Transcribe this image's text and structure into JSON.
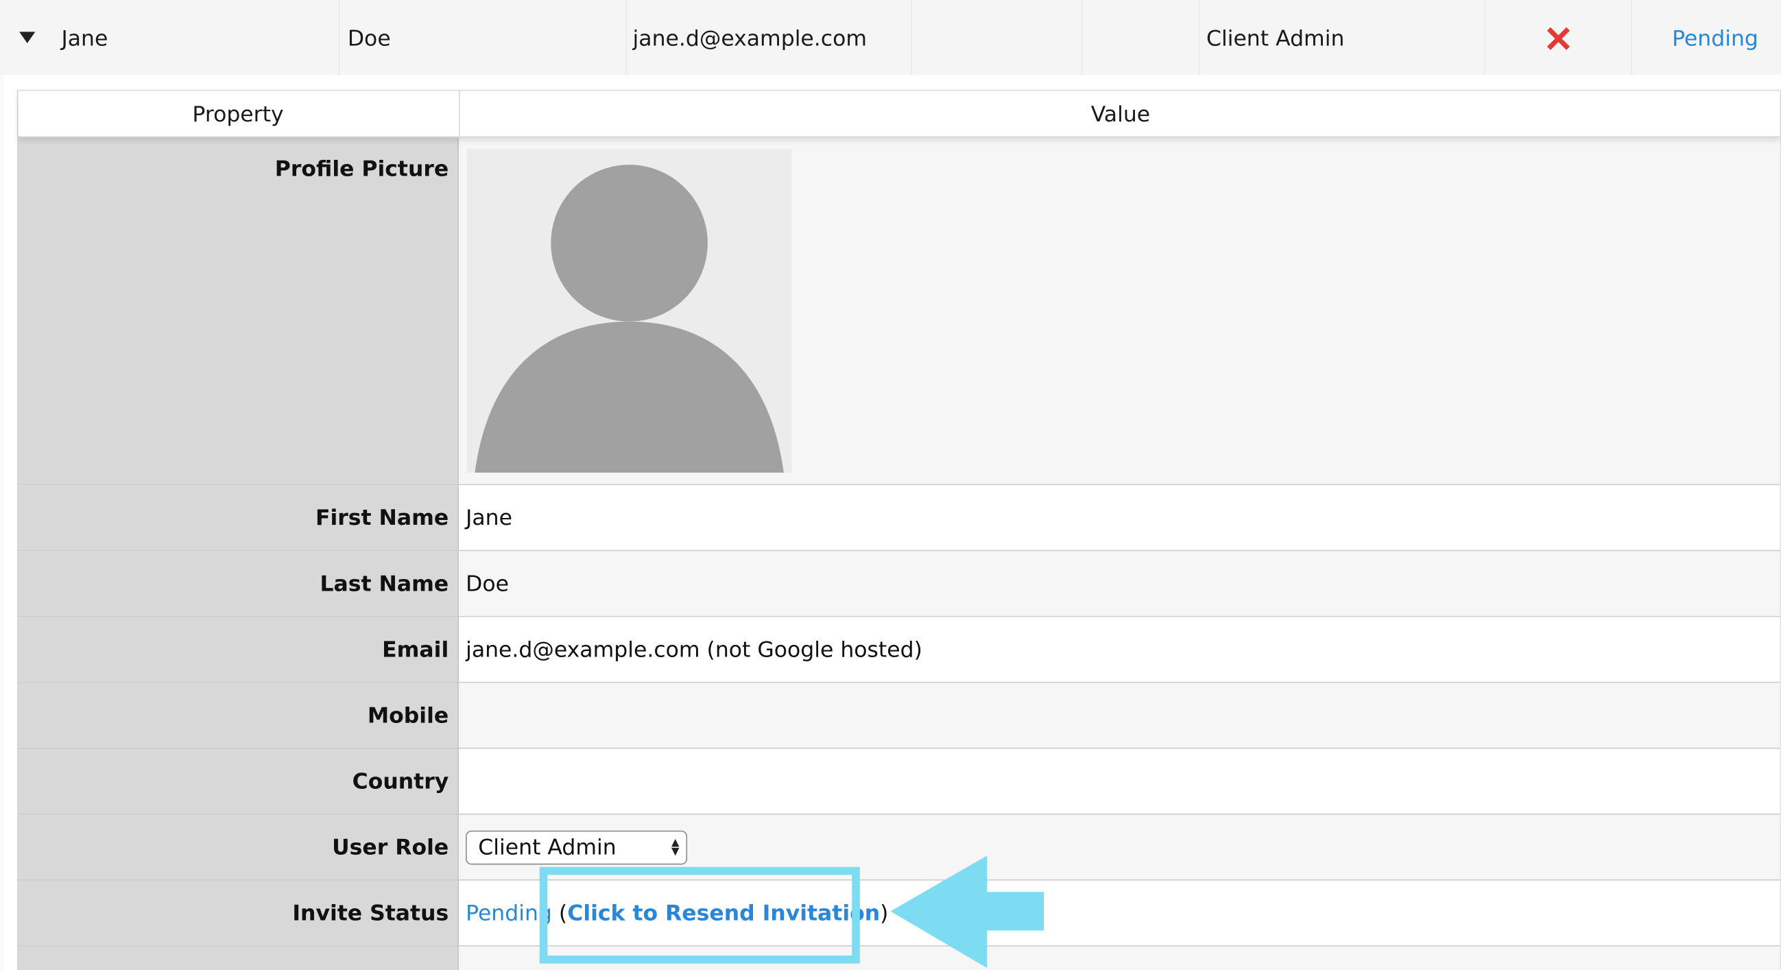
{
  "summary": {
    "first_name": "Jane",
    "last_name": "Doe",
    "email": "jane.d@example.com",
    "role": "Client Admin",
    "status": "Pending",
    "remove_icon": "x-icon",
    "expand_icon": "caret-down-icon"
  },
  "table": {
    "header_property": "Property",
    "header_value": "Value",
    "profile_picture_label": "Profile Picture",
    "rows": [
      {
        "label": "First Name",
        "value": "Jane"
      },
      {
        "label": "Last Name",
        "value": "Doe"
      },
      {
        "label": "Email",
        "value": "jane.d@example.com (not Google hosted)"
      },
      {
        "label": "Mobile",
        "value": ""
      },
      {
        "label": "Country",
        "value": ""
      }
    ],
    "user_role_label": "User Role",
    "user_role_selected": "Client Admin",
    "invite_status_label": "Invite Status",
    "invite_status_value": "Pending",
    "resend_open_paren": "(",
    "resend_link": "Click to Resend Invitation",
    "resend_close_paren": ")"
  },
  "colors": {
    "link": "#2a86d9",
    "highlight": "#7ddbf2",
    "remove": "#e53935"
  }
}
